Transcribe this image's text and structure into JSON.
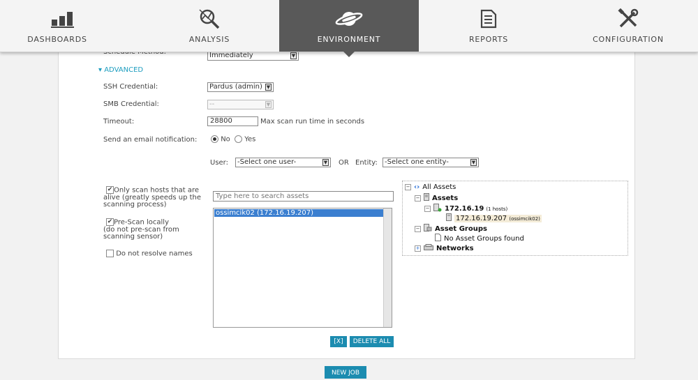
{
  "nav": {
    "items": [
      {
        "label": "DASHBOARDS",
        "icon": "bar-chart-icon",
        "active": false
      },
      {
        "label": "ANALYSIS",
        "icon": "magnifier-icon",
        "active": false
      },
      {
        "label": "ENVIRONMENT",
        "icon": "planet-icon",
        "active": true
      },
      {
        "label": "REPORTS",
        "icon": "report-doc-icon",
        "active": false
      },
      {
        "label": "CONFIGURATION",
        "icon": "tools-icon",
        "active": false
      }
    ]
  },
  "form": {
    "schedule_method_label": "Schedule Method:",
    "schedule_method_value": "Immediately",
    "advanced_label": "ADVANCED",
    "ssh_label": "SSH Credential:",
    "ssh_value": "Pardus (admin)",
    "smb_label": "SMB Credential:",
    "smb_value": "--",
    "timeout_label": "Timeout:",
    "timeout_value": "28800",
    "timeout_hint": "Max scan run time in seconds",
    "email_label": "Send an email notification:",
    "email_no": "No",
    "email_yes": "Yes",
    "email_selected": "No",
    "user_label": "User:",
    "user_value": "-Select one user-",
    "or_label": "OR",
    "entity_label": "Entity:",
    "entity_value": "-Select one entity-",
    "only_scan_line1": "Only scan hosts that are",
    "only_scan_line2": "alive (greatly speeds up the",
    "only_scan_line3": "scanning process)",
    "only_scan_checked": true,
    "prescan_line1": "Pre-Scan locally",
    "prescan_line2": "(do not pre-scan from",
    "prescan_line3": "scanning sensor)",
    "prescan_checked": true,
    "no_resolve_label": "Do not resolve names",
    "no_resolve_checked": false
  },
  "assets": {
    "search_placeholder": "Type here to search assets",
    "selected": [
      "ossimcik02 (172.16.19.207)"
    ],
    "remove_label": "[X]",
    "delete_all_label": "DELETE ALL"
  },
  "tree": {
    "root": "All Assets",
    "assets": "Assets",
    "subnet": "172.16.19",
    "subnet_count": "(1 hosts)",
    "host": "172.16.19.207",
    "host_name": "(ossimcik02)",
    "asset_groups": "Asset Groups",
    "no_groups": "No Asset Groups found",
    "networks": "Networks"
  },
  "footer": {
    "new_job_label": "NEW JOB"
  }
}
